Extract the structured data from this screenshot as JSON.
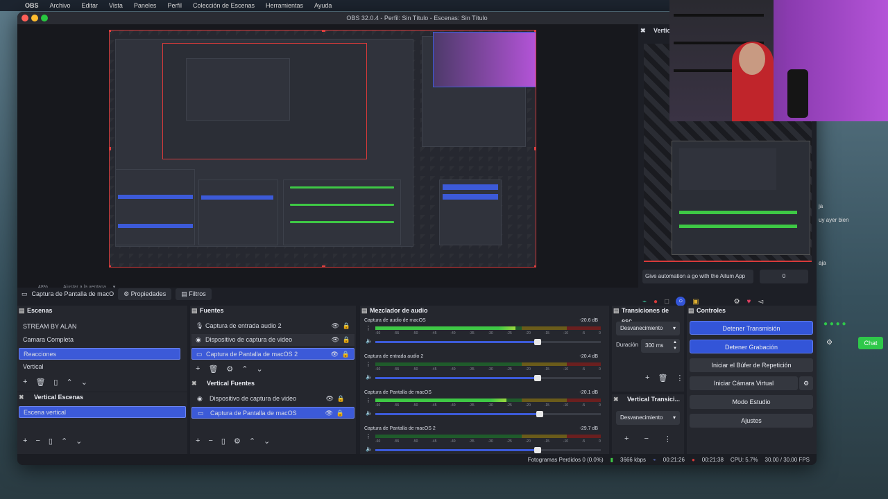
{
  "menubar": {
    "items": [
      "OBS",
      "Archivo",
      "Editar",
      "Vista",
      "Paneles",
      "Perfil",
      "Colección de Escenas",
      "Herramientas",
      "Ayuda"
    ]
  },
  "window": {
    "title": "OBS 32.0.4 - Perfil: Sin Título - Escenas: Sin Título"
  },
  "preview": {
    "zoom": "48%",
    "fit_label": "Ajustar a la ventana"
  },
  "vertical": {
    "title": "Vertica",
    "promo": "Give automation a go with the Aitum App",
    "promo_value": "0"
  },
  "source_toolbar": {
    "source_name": "Captura de Pantalla de macO",
    "properties": "Propiedades",
    "filters": "Filtros"
  },
  "scenes": {
    "title": "Escenas",
    "items": [
      "STREAM BY ALAN",
      "Camara Completa",
      "Reacciones",
      "Vertical"
    ],
    "selected": 2
  },
  "vertical_scenes": {
    "title": "Vertical Escenas",
    "items": [
      "Escena vertical"
    ]
  },
  "sources": {
    "title": "Fuentes",
    "items": [
      "Captura de entrada audio 2",
      "Dispositivo de captura de video",
      "Captura de Pantalla de macOS 2"
    ]
  },
  "vertical_sources": {
    "title": "Vertical Fuentes",
    "items": [
      "Dispositivo de captura de video",
      "Captura de Pantalla de macOS"
    ]
  },
  "mixer": {
    "title": "Mezclador de audio",
    "channels": [
      {
        "name": "Captura de audio de macOS",
        "db": "-20.6 dB",
        "level": 0.62,
        "vol": 0.72
      },
      {
        "name": "Captura de entrada audio 2",
        "db": "-20.4 dB",
        "level": 0.0,
        "vol": 0.72
      },
      {
        "name": "Captura de Pantalla de macOS",
        "db": "-20.1 dB",
        "level": 0.58,
        "vol": 0.73
      },
      {
        "name": "Captura de Pantalla de macOS 2",
        "db": "-29.7 dB",
        "level": 0.0,
        "vol": 0.72
      }
    ],
    "scale": [
      "-60",
      "-55",
      "-50",
      "-45",
      "-40",
      "-35",
      "-30",
      "-25",
      "-20",
      "-15",
      "-10",
      "-5",
      "0"
    ]
  },
  "transitions": {
    "title": "Transiciones de esc...",
    "type": "Desvanecimiento",
    "duration_label": "Duración",
    "duration": "300 ms"
  },
  "vertical_transitions": {
    "title": "Vertical Transici...",
    "type": "Desvanecimiento"
  },
  "controls": {
    "title": "Controles",
    "buttons": [
      "Detener Transmisión",
      "Detener Grabación",
      "Iniciar el Búfer de Repetición",
      "Iniciar Cámara Virtual",
      "Modo Estudio",
      "Ajustes"
    ]
  },
  "status": {
    "dropped": "Fotogramas Perdidos 0 (0.0%)",
    "bitrate": "3666 kbps",
    "stream_time": "00:21:26",
    "rec_time": "00:21:38",
    "cpu": "CPU: 5.7%",
    "fps": "30.00 / 30.00 FPS"
  },
  "chat_side": {
    "lines": [
      "ja",
      "uy ayer bien",
      "aja"
    ],
    "button": "Chat"
  },
  "colors": {
    "accent": "#3355d8",
    "record": "#d83a3a",
    "chat": "#2fc84a"
  }
}
